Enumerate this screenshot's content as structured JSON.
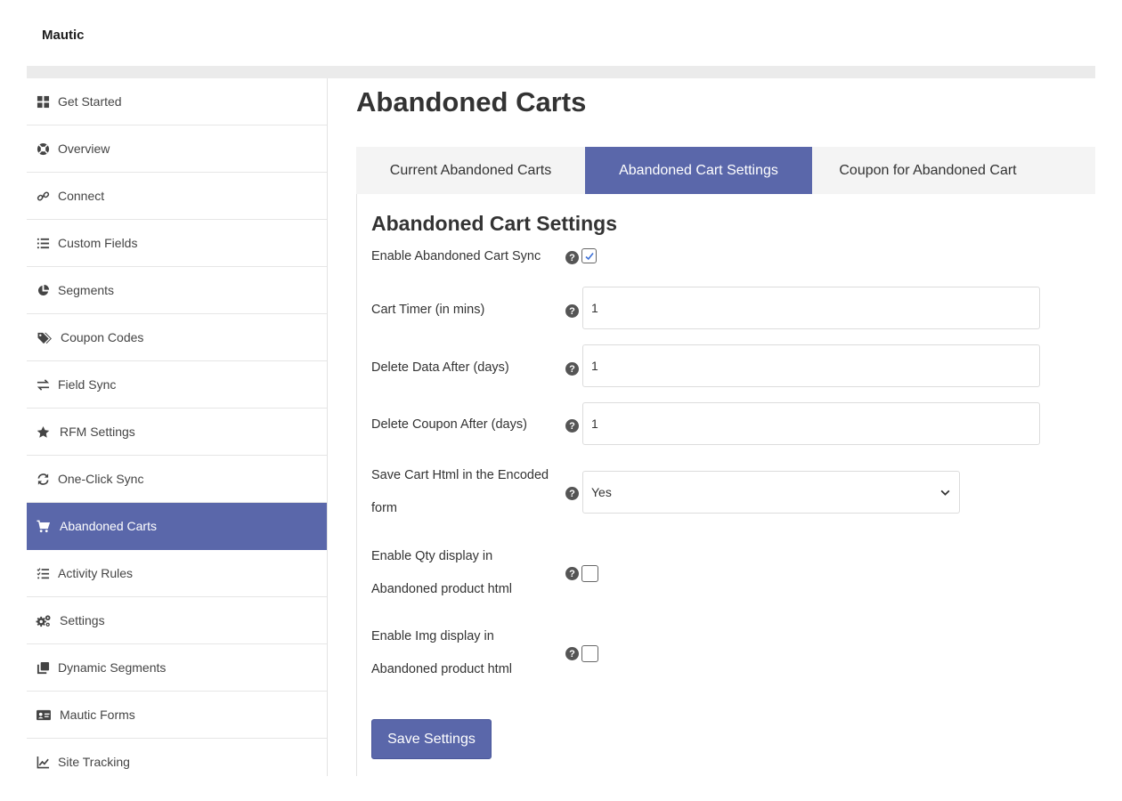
{
  "app": {
    "brand": "Mautic"
  },
  "sidebar": {
    "items": [
      {
        "label": "Get Started",
        "icon": "grid-icon"
      },
      {
        "label": "Overview",
        "icon": "lifebuoy-icon"
      },
      {
        "label": "Connect",
        "icon": "link-icon"
      },
      {
        "label": "Custom Fields",
        "icon": "list-icon"
      },
      {
        "label": "Segments",
        "icon": "pie-chart-icon"
      },
      {
        "label": "Coupon Codes",
        "icon": "tags-icon"
      },
      {
        "label": "Field Sync",
        "icon": "exchange-icon"
      },
      {
        "label": "RFM Settings",
        "icon": "star-icon"
      },
      {
        "label": "One-Click Sync",
        "icon": "sync-icon"
      },
      {
        "label": "Abandoned Carts",
        "icon": "cart-icon",
        "active": true
      },
      {
        "label": "Activity Rules",
        "icon": "tasks-icon"
      },
      {
        "label": "Settings",
        "icon": "cogs-icon"
      },
      {
        "label": "Dynamic Segments",
        "icon": "clone-icon"
      },
      {
        "label": "Mautic Forms",
        "icon": "id-card-icon"
      },
      {
        "label": "Site Tracking",
        "icon": "line-chart-icon"
      }
    ]
  },
  "main": {
    "title": "Abandoned Carts",
    "tabs": [
      {
        "label": "Current Abandoned Carts"
      },
      {
        "label": "Abandoned Cart Settings",
        "active": true
      },
      {
        "label": "Coupon for Abandoned Cart"
      }
    ]
  },
  "settings": {
    "title": "Abandoned Cart Settings",
    "enable_sync": {
      "label": "Enable Abandoned Cart Sync",
      "checked": true
    },
    "cart_timer": {
      "label": "Cart Timer (in mins)",
      "value": "1"
    },
    "delete_data": {
      "label": "Delete Data After (days)",
      "value": "1"
    },
    "delete_coupon": {
      "label": "Delete Coupon After (days)",
      "value": "1"
    },
    "save_cart_html": {
      "label": "Save Cart Html in the Encoded form",
      "value": "Yes"
    },
    "enable_qty": {
      "label": "Enable Qty display in Abandoned product html",
      "checked": false
    },
    "enable_img": {
      "label": "Enable Img display in Abandoned product html",
      "checked": false
    },
    "help_glyph": "?",
    "save_button": "Save Settings"
  },
  "colors": {
    "accent": "#5a67aa",
    "divider": "#e6e6e6"
  }
}
